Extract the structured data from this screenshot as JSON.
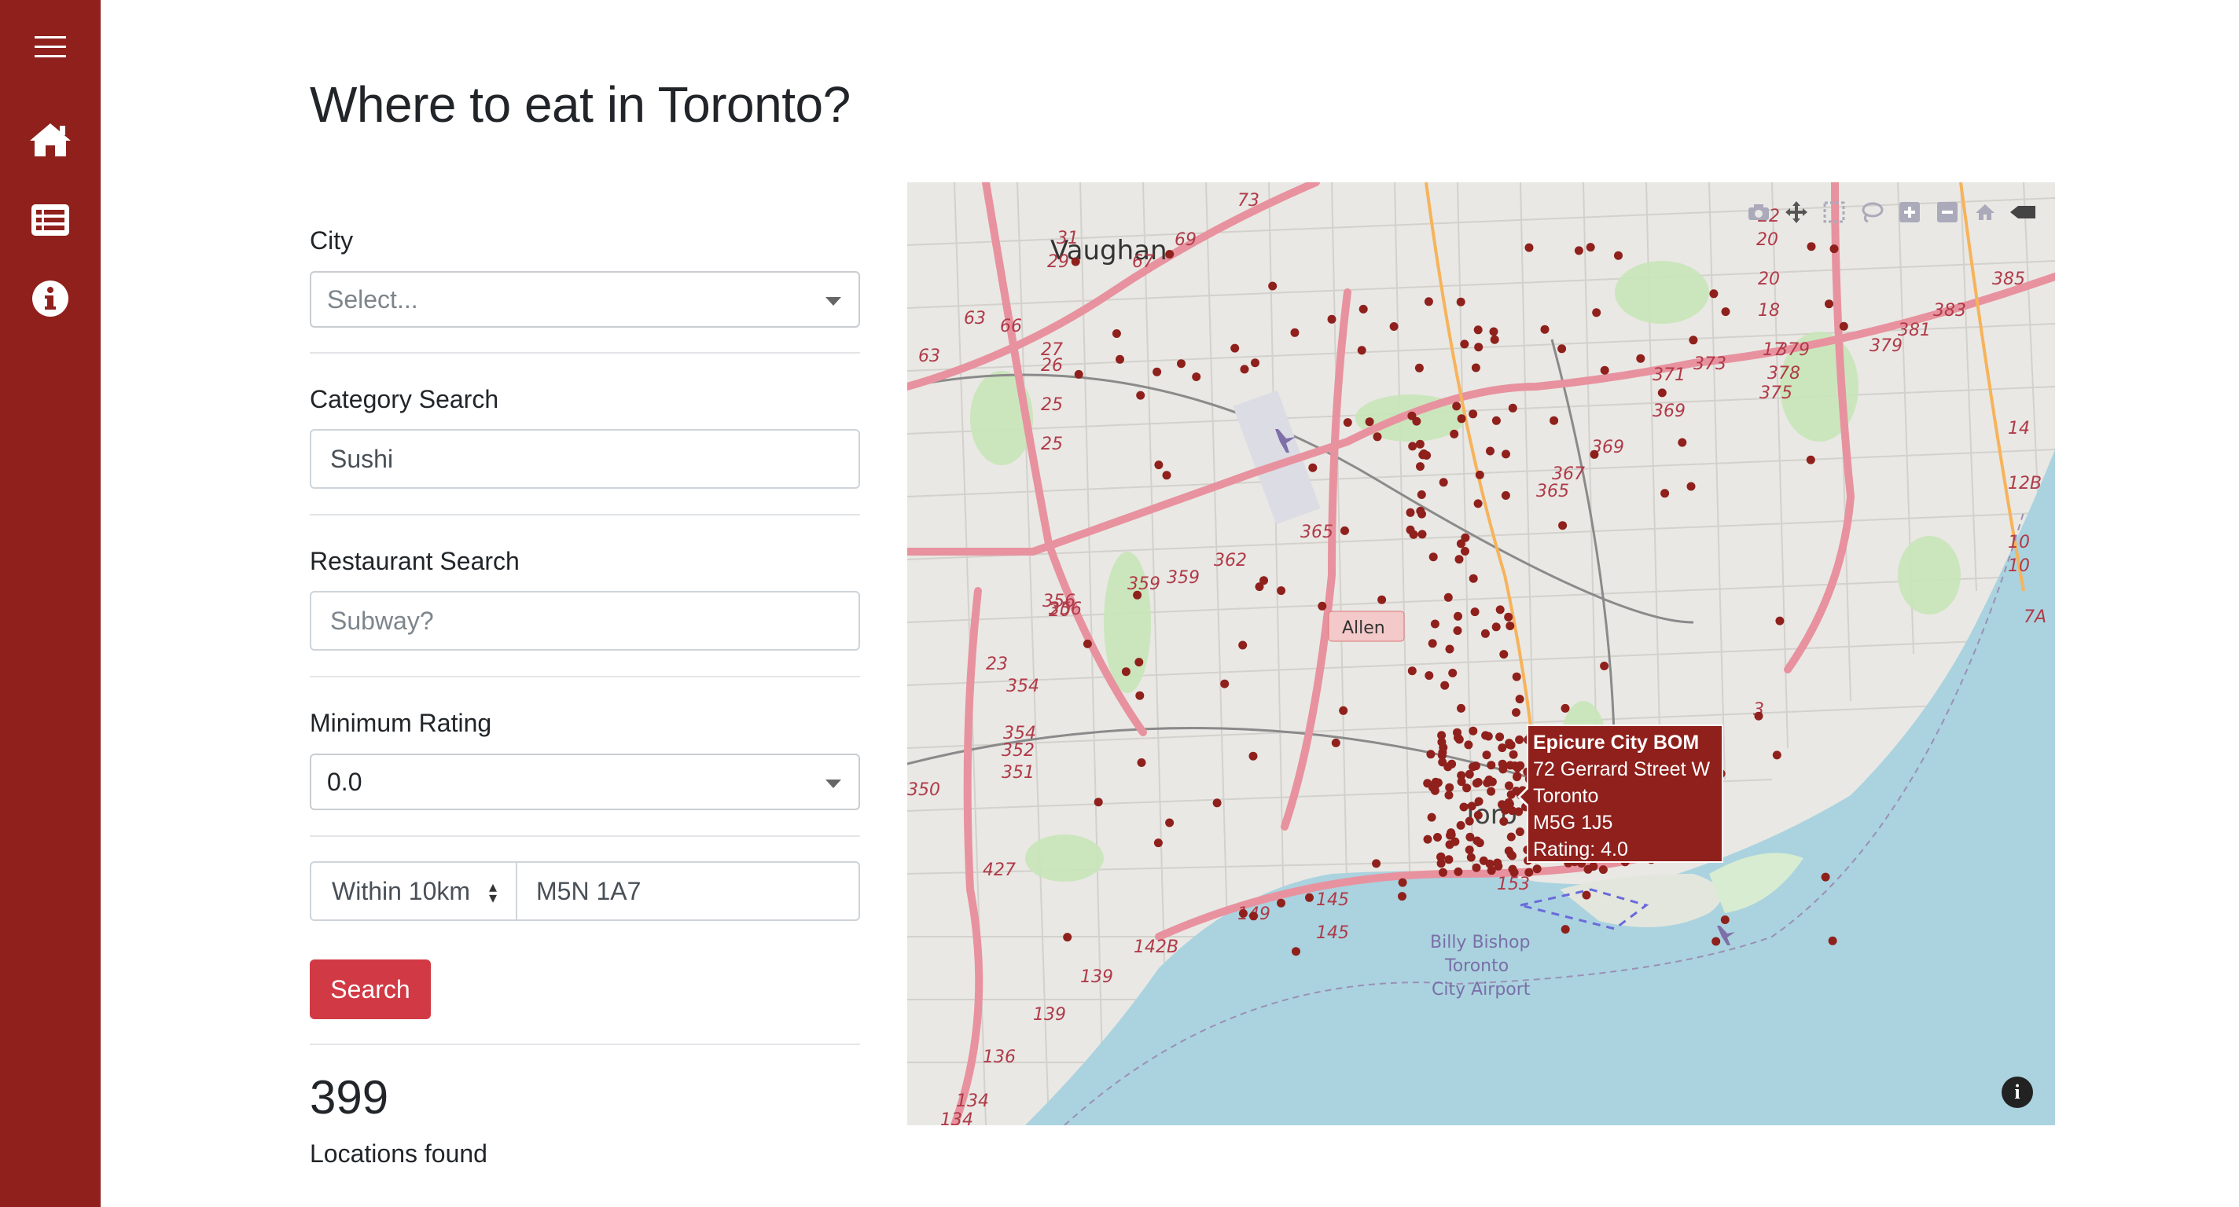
{
  "page": {
    "title": "Where to eat in Toronto?"
  },
  "sidebar": {
    "items": [
      {
        "icon": "hamburger-icon"
      },
      {
        "icon": "home-icon"
      },
      {
        "icon": "list-icon"
      },
      {
        "icon": "info-circle-icon"
      }
    ],
    "color": "#8f201c"
  },
  "form": {
    "city": {
      "label": "City",
      "placeholder": "Select..."
    },
    "category": {
      "label": "Category Search",
      "value": "Sushi"
    },
    "restaurant": {
      "label": "Restaurant Search",
      "placeholder": "Subway?"
    },
    "rating": {
      "label": "Minimum Rating",
      "value": "0.0"
    },
    "distance": {
      "value": "Within 10km"
    },
    "postal": {
      "value": "M5N 1A7"
    },
    "search_label": "Search",
    "button_color": "#d13a44"
  },
  "results": {
    "count": "399",
    "label": "Locations found"
  },
  "map": {
    "places": {
      "vaughan": "Vaughan",
      "allen": "Allen",
      "toronto": "Toro",
      "airport_1": "Billy Bishop",
      "airport_2": "Toronto",
      "airport_3": "City Airport"
    },
    "route_labels": [
      "31",
      "29",
      "67",
      "69",
      "63",
      "66",
      "63",
      "27",
      "26",
      "25",
      "25",
      "73",
      "22",
      "20",
      "20",
      "18",
      "17",
      "385",
      "383",
      "381",
      "379",
      "379",
      "378",
      "375",
      "373",
      "371",
      "369",
      "369",
      "367",
      "365",
      "365",
      "14",
      "12B",
      "10",
      "10",
      "7A",
      "362",
      "359",
      "359",
      "356",
      "356",
      "23",
      "20",
      "354",
      "354",
      "352",
      "351",
      "350",
      "3",
      "427",
      "145",
      "145",
      "149",
      "153",
      "142B",
      "139",
      "139",
      "136",
      "134",
      "134"
    ],
    "marker_color": "#8f201c",
    "tooltip": {
      "name": "Epicure City BOM",
      "address": "72 Gerrard Street W",
      "city": "Toronto",
      "postal": "M5G 1J5",
      "rating": "Rating: 4.0"
    },
    "modebar_icons": [
      "camera-icon",
      "pan-icon",
      "box-select-icon",
      "lasso-icon",
      "zoom-in-icon",
      "zoom-out-icon",
      "reset-home-icon",
      "collapse-icon"
    ]
  }
}
